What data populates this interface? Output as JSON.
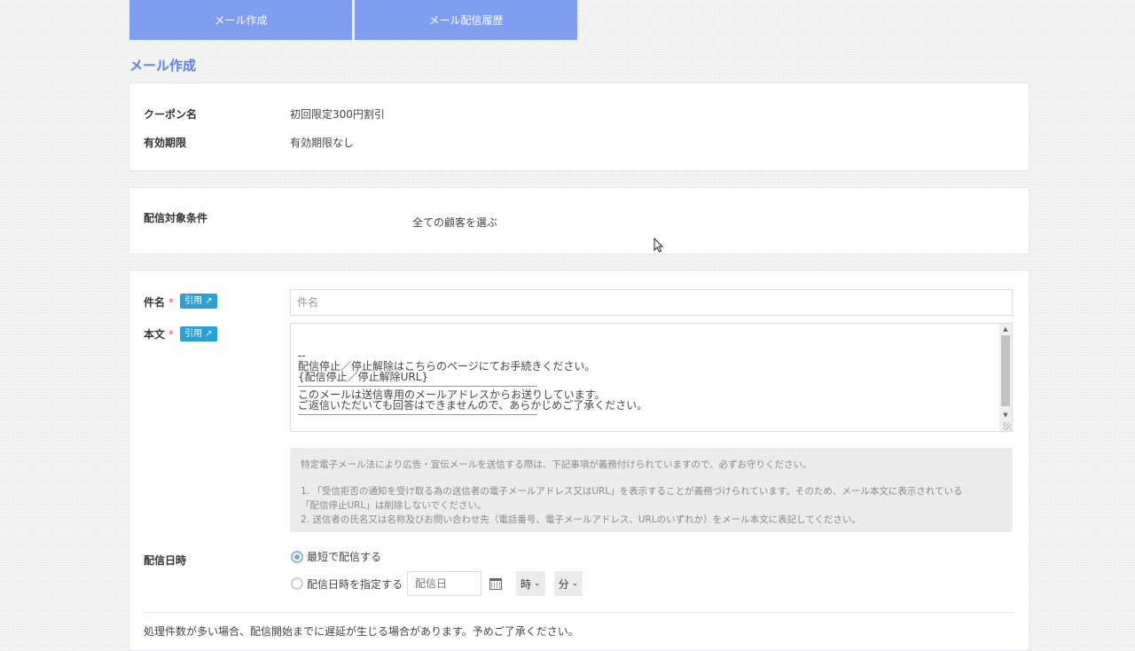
{
  "tabs": [
    {
      "label": "メール作成"
    },
    {
      "label": "メール配信履歴"
    }
  ],
  "page_title": "メール作成",
  "coupon": {
    "name_label": "クーポン名",
    "name_value": "初回限定300円割引",
    "expiry_label": "有効期限",
    "expiry_value": "有効期限なし"
  },
  "target": {
    "label": "配信対象条件",
    "value": "全ての顧客を選ぶ"
  },
  "form": {
    "required_mark": "*",
    "subject_label": "件名",
    "subject_quote_badge": "引用",
    "subject_placeholder": "件名",
    "body_label": "本文",
    "body_quote_badge": "引用",
    "body_lines": [
      "--",
      "配信停止／停止解除はこちらのページにてお手続きください。",
      "{配信停止／停止解除URL}",
      "このメールは送信専用のメールアドレスからお送りしています。",
      "ご返信いただいても回答はできませんので、あらかじめご了承ください。"
    ],
    "notice": {
      "intro": "特定電子メール法により広告・宣伝メールを送信する際は、下記事項が義務付けられていますので、必ずお守りください。",
      "item1a": "1. 「受信拒否の通知を受け取る為の送信者の電子メールアドレス又はURL」を表示することが義務づけられています。そのため、メール本文に表示されている",
      "item1b": "「配信停止URL」は削除しないでください。",
      "item2": "2. 送信者の氏名又は名称及びお問い合わせ先（電話番号、電子メールアドレス、URLのいずれか）をメール本文に表記してください。"
    },
    "schedule_label": "配信日時",
    "schedule_option_fastest": "最短で配信する",
    "schedule_option_specify": "配信日時を指定する",
    "date_placeholder": "配信日",
    "hour_select": "時",
    "minute_select": "分",
    "footnote": "処理件数が多い場合、配信開始までに遅延が生じる場合があります。予めご了承ください。"
  },
  "colors": {
    "tab_bg": "#7f9ef0",
    "title": "#5b82e6",
    "badge": "#2a9fd8",
    "required": "#e04a4a"
  }
}
